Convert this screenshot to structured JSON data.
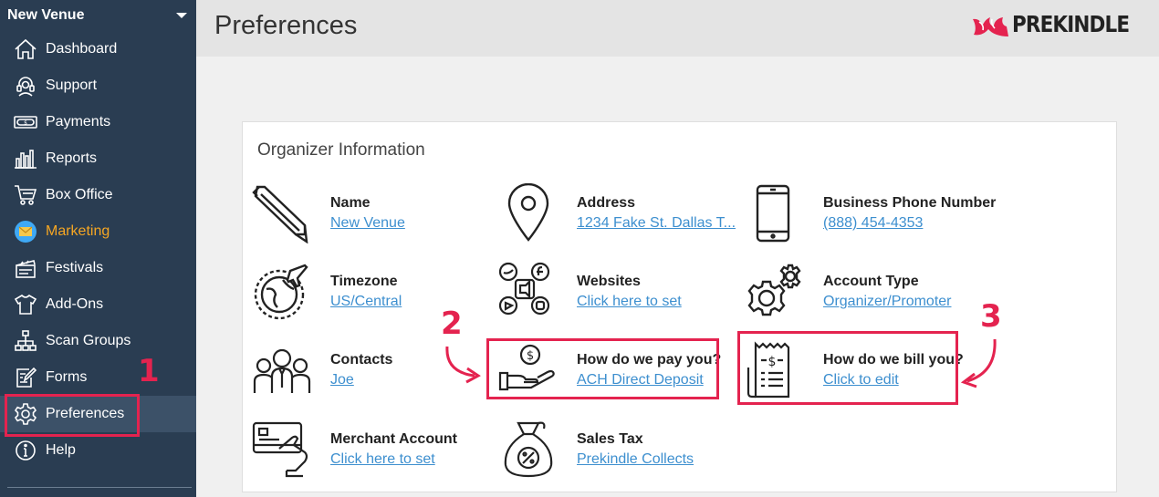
{
  "sidebar": {
    "venue": "New Venue",
    "items": [
      {
        "label": "Dashboard"
      },
      {
        "label": "Support"
      },
      {
        "label": "Payments"
      },
      {
        "label": "Reports"
      },
      {
        "label": "Box Office"
      },
      {
        "label": "Marketing"
      },
      {
        "label": "Festivals"
      },
      {
        "label": "Add-Ons"
      },
      {
        "label": "Scan Groups"
      },
      {
        "label": "Forms"
      },
      {
        "label": "Preferences"
      },
      {
        "label": "Help"
      }
    ]
  },
  "header": {
    "title": "Preferences",
    "logo": "PREKINDLE"
  },
  "card": {
    "title": "Organizer Information",
    "items": [
      {
        "label": "Name",
        "value": "New Venue"
      },
      {
        "label": "Address",
        "value": "1234 Fake St. Dallas T..."
      },
      {
        "label": "Business Phone Number",
        "value": "(888) 454-4353"
      },
      {
        "label": "Timezone",
        "value": "US/Central"
      },
      {
        "label": "Websites",
        "value": "Click here to set"
      },
      {
        "label": "Account Type",
        "value": "Organizer/Promoter"
      },
      {
        "label": "Contacts",
        "value": "Joe"
      },
      {
        "label": "How do we pay you?",
        "value": "ACH Direct Deposit"
      },
      {
        "label": "How do we bill you?",
        "value": "Click to edit"
      },
      {
        "label": "Merchant Account",
        "value": "Click here to set"
      },
      {
        "label": "Sales Tax",
        "value": "Prekindle Collects"
      }
    ]
  },
  "annotations": {
    "n1": "1",
    "n2": "2",
    "n3": "3"
  },
  "colors": {
    "sidebar": "#2a3d52",
    "accent": "#e4234f",
    "link": "#3d8fcf",
    "marketing": "#f5a623"
  }
}
